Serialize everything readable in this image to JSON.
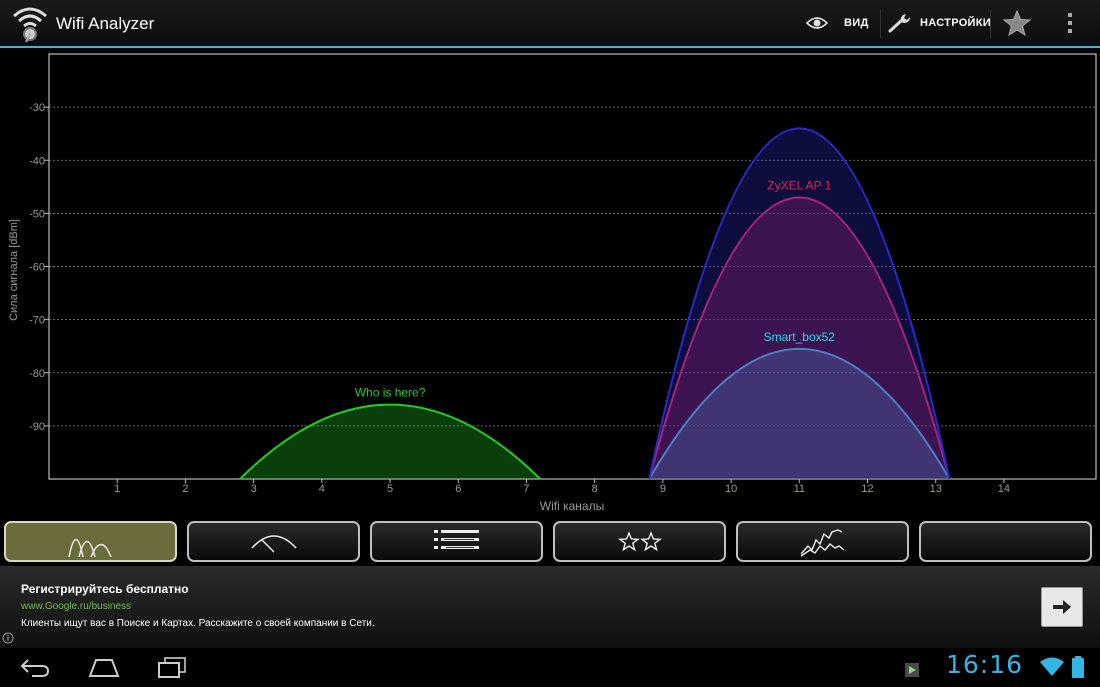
{
  "app": {
    "title": "Wifi Analyzer"
  },
  "toolbar": {
    "view_label": "ВИД",
    "settings_label": "НАСТРОЙКИ"
  },
  "chart_data": {
    "type": "area",
    "xlabel": "Wifi каналы",
    "ylabel": "Сила сигнала [dBm]",
    "xlim": [
      0,
      15.35
    ],
    "ylim": [
      -100,
      -20
    ],
    "x_ticks": [
      1,
      2,
      3,
      4,
      5,
      6,
      7,
      8,
      9,
      10,
      11,
      12,
      13,
      14
    ],
    "y_ticks": [
      -30,
      -40,
      -50,
      -60,
      -70,
      -80,
      -90
    ],
    "grid": true,
    "networks": [
      {
        "name": "Who is here?",
        "channel": 5,
        "level": -86,
        "color": "#22cc22"
      },
      {
        "name": "Smart_box52",
        "channel": 11,
        "level": -75.5,
        "color": "#22ddee"
      },
      {
        "name": "ZyXEL AP 1",
        "channel": 11,
        "level": -47,
        "color": "#dd2255"
      },
      {
        "name": "",
        "channel": 11,
        "level": -34,
        "color": "#2a2acc"
      }
    ]
  },
  "tabs": [
    {
      "icon": "channel-graph-icon"
    },
    {
      "icon": "signal-meter-icon"
    },
    {
      "icon": "ap-list-icon"
    },
    {
      "icon": "channel-rating-icon"
    },
    {
      "icon": "time-graph-icon"
    },
    {
      "icon": ""
    }
  ],
  "ad": {
    "title": "Регистрируйтесь бесплатно",
    "url": "www.Google.ru/business",
    "text": "Клиенты ищут вас в Поиске и Картах. Расскажите о своей компании в Сети."
  },
  "status": {
    "time": "16:16"
  }
}
